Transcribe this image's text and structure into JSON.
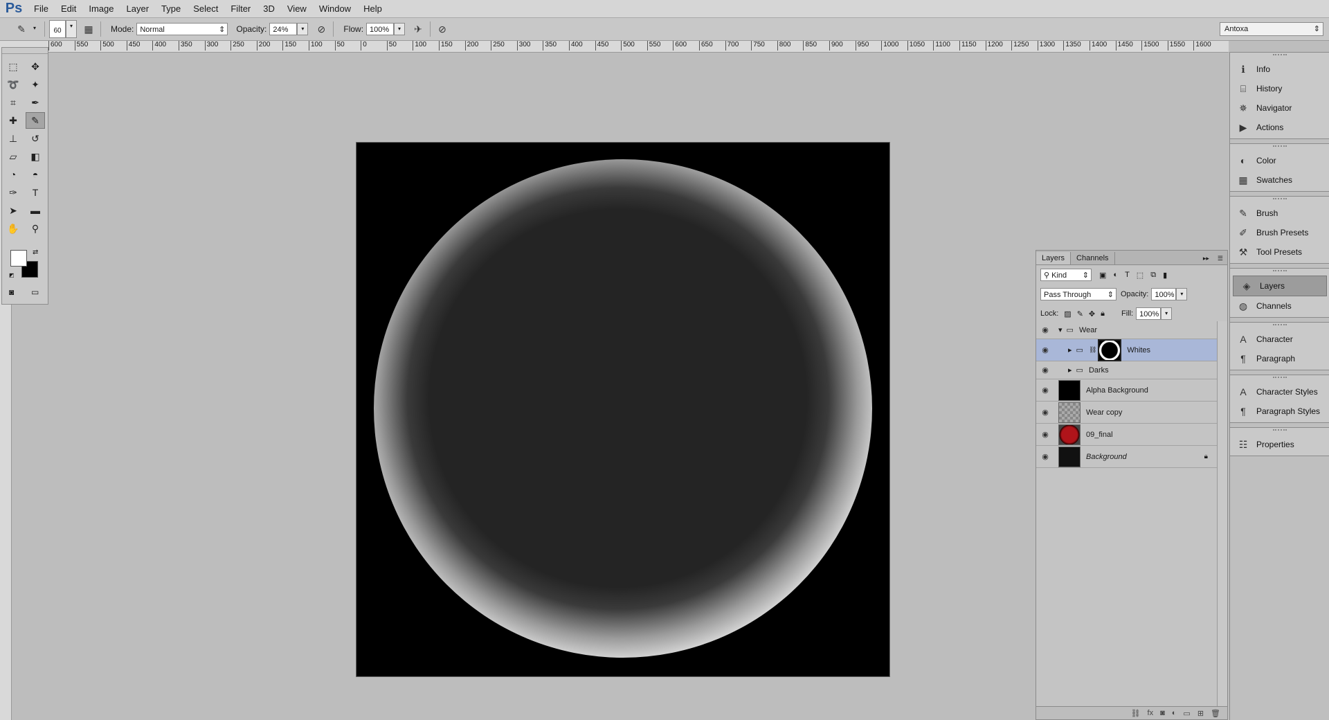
{
  "app": {
    "logo": "Ps"
  },
  "menu": [
    "File",
    "Edit",
    "Image",
    "Layer",
    "Type",
    "Select",
    "Filter",
    "3D",
    "View",
    "Window",
    "Help"
  ],
  "options": {
    "brush_size": "60",
    "mode_label": "Mode:",
    "mode_value": "Normal",
    "opacity_label": "Opacity:",
    "opacity_value": "24%",
    "flow_label": "Flow:",
    "flow_value": "100%",
    "workspace": "Antoxa"
  },
  "ruler_ticks": [
    "600",
    "550",
    "500",
    "450",
    "400",
    "350",
    "300",
    "250",
    "200",
    "150",
    "100",
    "50",
    "0",
    "50",
    "100",
    "150",
    "200",
    "250",
    "300",
    "350",
    "400",
    "450",
    "500",
    "550",
    "600",
    "650",
    "700",
    "750",
    "800",
    "850",
    "900",
    "950",
    "1000",
    "1050",
    "1100",
    "1150",
    "1200",
    "1250",
    "1300",
    "1350",
    "1400",
    "1450",
    "1500",
    "1550",
    "1600"
  ],
  "panel_strip": [
    {
      "items": [
        {
          "label": "Info",
          "icon": "info-icon",
          "glyph": "ℹ"
        },
        {
          "label": "History",
          "icon": "history-icon",
          "glyph": "⌸"
        },
        {
          "label": "Navigator",
          "icon": "navigator-icon",
          "glyph": "✵"
        },
        {
          "label": "Actions",
          "icon": "actions-icon",
          "glyph": "▶"
        }
      ]
    },
    {
      "items": [
        {
          "label": "Color",
          "icon": "color-icon",
          "glyph": "◐"
        },
        {
          "label": "Swatches",
          "icon": "swatches-icon",
          "glyph": "▦"
        }
      ]
    },
    {
      "items": [
        {
          "label": "Brush",
          "icon": "brush-icon",
          "glyph": "✎"
        },
        {
          "label": "Brush Presets",
          "icon": "brush-presets-icon",
          "glyph": "✐"
        },
        {
          "label": "Tool Presets",
          "icon": "tool-presets-icon",
          "glyph": "⚒"
        }
      ]
    },
    {
      "items": [
        {
          "label": "Layers",
          "icon": "layers-icon",
          "glyph": "◈",
          "active": true
        },
        {
          "label": "Channels",
          "icon": "channels-icon",
          "glyph": "◍"
        }
      ]
    },
    {
      "items": [
        {
          "label": "Character",
          "icon": "character-icon",
          "glyph": "A"
        },
        {
          "label": "Paragraph",
          "icon": "paragraph-icon",
          "glyph": "¶"
        }
      ]
    },
    {
      "items": [
        {
          "label": "Character Styles",
          "icon": "character-styles-icon",
          "glyph": "A"
        },
        {
          "label": "Paragraph Styles",
          "icon": "paragraph-styles-icon",
          "glyph": "¶"
        }
      ]
    },
    {
      "items": [
        {
          "label": "Properties",
          "icon": "properties-icon",
          "glyph": "☷"
        }
      ]
    }
  ],
  "layers_panel": {
    "tabs": [
      "Layers",
      "Channels"
    ],
    "filter": "Kind",
    "blend_mode": "Pass Through",
    "opacity_label": "Opacity:",
    "opacity_value": "100%",
    "lock_label": "Lock:",
    "fill_label": "Fill:",
    "fill_value": "100%",
    "layers": [
      {
        "name": "Wear",
        "type": "group-open",
        "indent": 0
      },
      {
        "name": "Whites",
        "type": "group-closed",
        "indent": 1,
        "selected": true,
        "mask": true
      },
      {
        "name": "Darks",
        "type": "group-closed",
        "indent": 1
      },
      {
        "name": "Alpha Background",
        "type": "smart",
        "thumb": "#000000"
      },
      {
        "name": "Wear copy",
        "type": "transparent"
      },
      {
        "name": "09_final",
        "type": "smart-red"
      },
      {
        "name": "Background",
        "type": "background",
        "italic": true,
        "locked": true,
        "thumb": "#111111"
      }
    ]
  },
  "colors": {
    "foreground": "#ffffff",
    "background": "#000000",
    "selection": "#a9b7d8"
  }
}
